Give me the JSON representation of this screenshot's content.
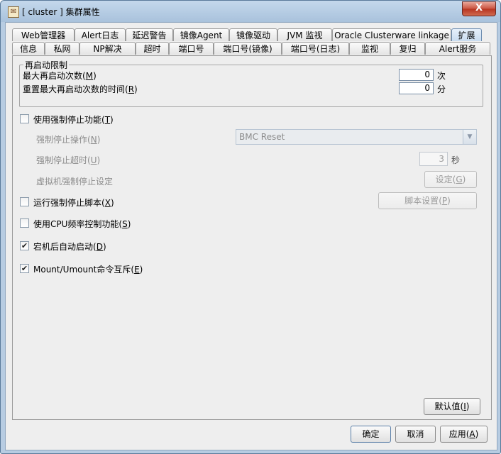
{
  "window": {
    "title": "[ cluster ] 集群属性",
    "close_glyph": "X",
    "app_icon_glyph": "✉"
  },
  "tabs": {
    "row_top": [
      "Web管理器",
      "Alert日志",
      "延迟警告",
      "镜像Agent",
      "镜像驱动",
      "JVM 监视",
      "Oracle Clusterware linkage",
      "扩展"
    ],
    "row_bottom": [
      "信息",
      "私网",
      "NP解决",
      "超时",
      "端口号",
      "端口号(镜像)",
      "端口号(日志)",
      "监视",
      "复归",
      "Alert服务"
    ],
    "active": "扩展"
  },
  "restart_group": {
    "title": "再启动限制",
    "max_restart": {
      "label": "最大再启动次数",
      "mnemonic": "M",
      "value": "0",
      "unit": "次"
    },
    "reset_time": {
      "label": "重置最大再启动次数的时间",
      "mnemonic": "R",
      "value": "0",
      "unit": "分"
    }
  },
  "forced_stop": {
    "label": "使用强制停止功能",
    "mnemonic": "T",
    "checked": false,
    "action": {
      "label": "强制停止操作",
      "mnemonic": "N",
      "value": "BMC Reset"
    },
    "timeout": {
      "label": "强制停止超时",
      "mnemonic": "U",
      "value": "3",
      "unit": "秒"
    },
    "vm": {
      "label": "虚拟机强制停止设定",
      "button": "设定",
      "mnemonic": "G"
    }
  },
  "script": {
    "label": "运行强制停止脚本",
    "mnemonic": "X",
    "checked": false,
    "button": "脚本设置",
    "button_mnemonic": "P"
  },
  "cpu": {
    "label": "使用CPU频率控制功能",
    "mnemonic": "S",
    "checked": false
  },
  "auto_start": {
    "label": "宕机后自动启动",
    "mnemonic": "D",
    "checked": true
  },
  "mount": {
    "label": "Mount/Umount命令互斥",
    "mnemonic": "E",
    "checked": true
  },
  "check_glyph": "✔",
  "buttons": {
    "default": {
      "label": "默认值",
      "mnemonic": "I"
    },
    "ok": "确定",
    "cancel": "取消",
    "apply": {
      "label": "应用",
      "mnemonic": "A"
    }
  }
}
